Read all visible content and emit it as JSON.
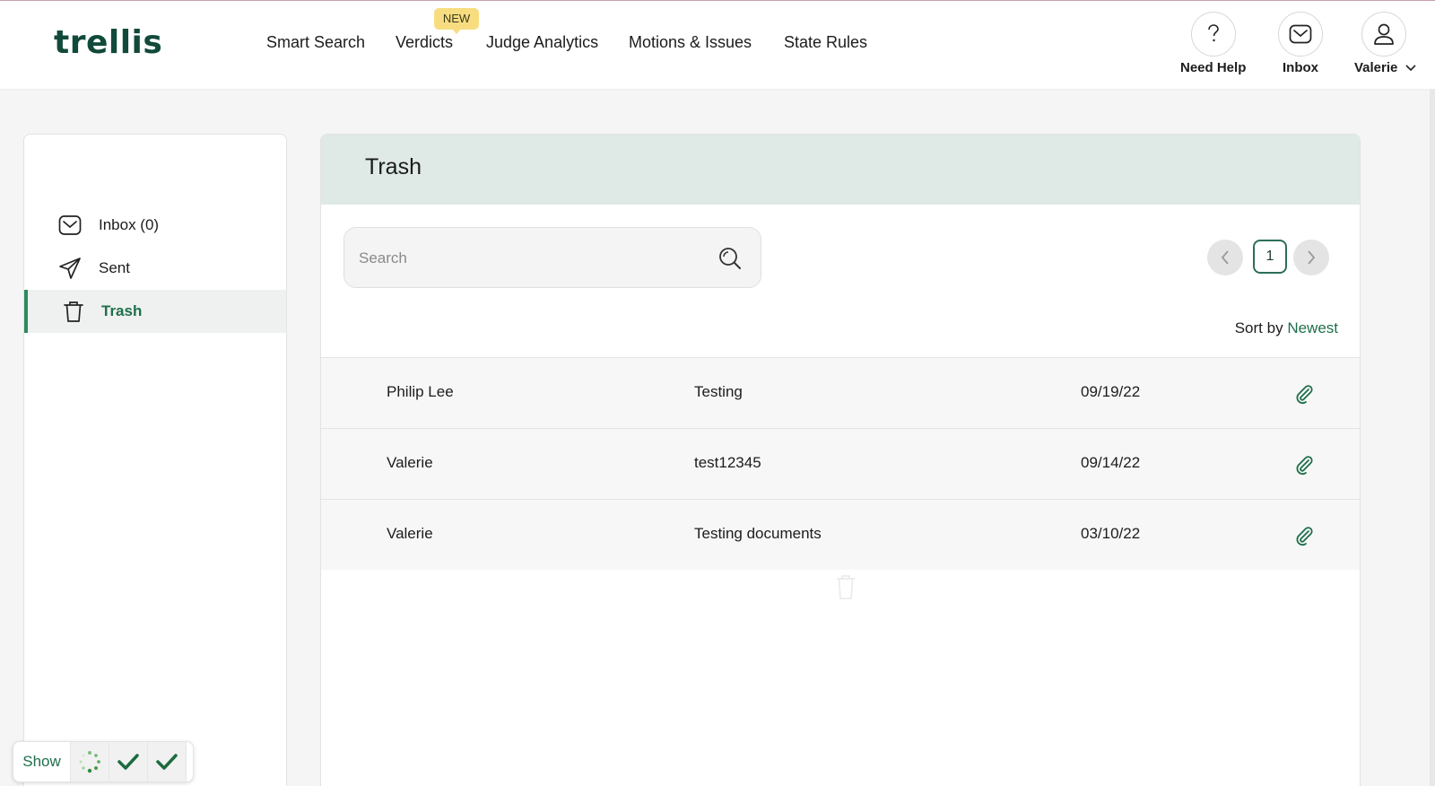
{
  "header": {
    "logo": "trellis",
    "nav": [
      {
        "label": "Smart Search"
      },
      {
        "label": "Verdicts"
      },
      {
        "label": "Judge Analytics"
      },
      {
        "label": "Motions & Issues"
      },
      {
        "label": "State Rules"
      }
    ],
    "new_badge": "NEW",
    "help_label": "Need Help",
    "inbox_label": "Inbox",
    "user_label": "Valerie"
  },
  "sidebar": {
    "items": [
      {
        "label": "Inbox (0)",
        "icon": "envelope-icon"
      },
      {
        "label": "Sent",
        "icon": "paper-plane-icon"
      },
      {
        "label": "Trash",
        "icon": "trash-icon",
        "active": true
      }
    ]
  },
  "main": {
    "title": "Trash",
    "search_placeholder": "Search",
    "page": "1",
    "sort_label": "Sort by",
    "sort_value": "Newest",
    "rows": [
      {
        "from": "Philip Lee",
        "subject": "Testing",
        "date": "09/19/22"
      },
      {
        "from": "Valerie",
        "subject": "test12345",
        "date": "09/14/22"
      },
      {
        "from": "Valerie",
        "subject": "Testing documents",
        "date": "03/10/22"
      }
    ]
  },
  "widget": {
    "show_label": "Show"
  },
  "colors": {
    "brand": "#114a3a",
    "accent": "#1f6f4b",
    "header_band": "#dfe9e5",
    "badge": "#f8dd80"
  }
}
